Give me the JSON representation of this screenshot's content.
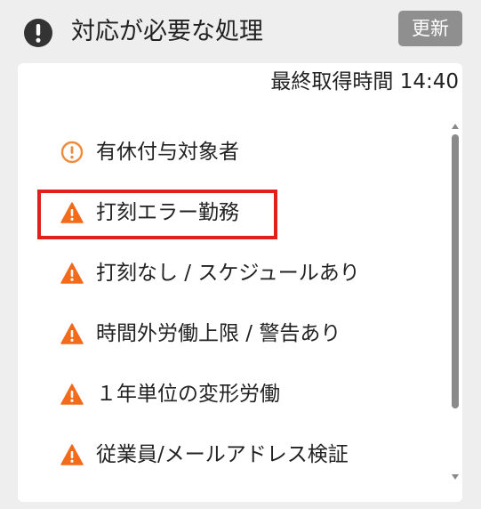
{
  "header": {
    "title": "対応が必要な処理",
    "refresh_label": "更新"
  },
  "panel": {
    "timestamp": "最終取得時間 14:40"
  },
  "items": [
    {
      "label": "有休付与対象者",
      "icon": "info-circle-icon",
      "icon_color": "#f08a3c"
    },
    {
      "label": "打刻エラー勤務",
      "icon": "warning-triangle-icon",
      "icon_color": "#f26a1b",
      "highlighted": true
    },
    {
      "label": "打刻なし / スケジュールあり",
      "icon": "warning-triangle-icon",
      "icon_color": "#f26a1b"
    },
    {
      "label": "時間外労働上限 / 警告あり",
      "icon": "warning-triangle-icon",
      "icon_color": "#f26a1b"
    },
    {
      "label": "１年単位の変形労働",
      "icon": "warning-triangle-icon",
      "icon_color": "#f26a1b"
    },
    {
      "label": "従業員/メールアドレス検証",
      "icon": "warning-triangle-icon",
      "icon_color": "#f26a1b"
    }
  ],
  "colors": {
    "header_icon": "#333333",
    "refresh_button": "#8f8f8f",
    "highlight_border": "#e0201c",
    "warning": "#f26a1b"
  }
}
